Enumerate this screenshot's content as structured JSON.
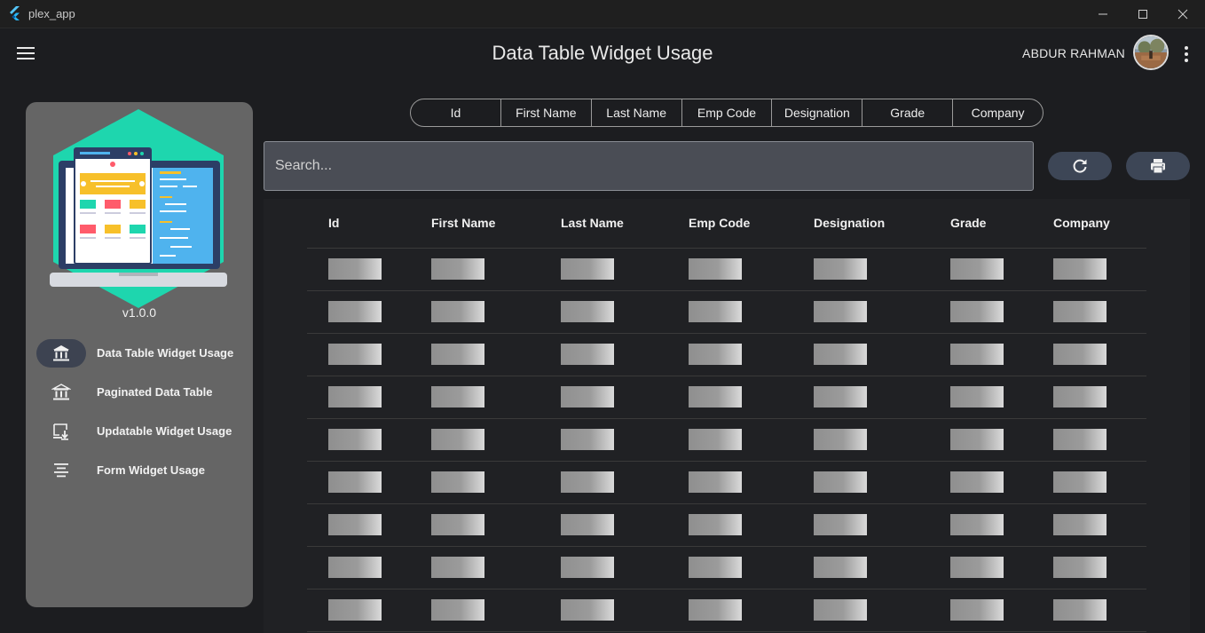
{
  "window": {
    "title": "plex_app"
  },
  "appbar": {
    "title": "Data Table Widget Usage",
    "user_name": "ABDUR RAHMAN"
  },
  "sidebar": {
    "version": "v1.0.0",
    "items": [
      {
        "label": "Data Table Widget Usage",
        "icon": "bank-icon",
        "active": true
      },
      {
        "label": "Paginated Data Table",
        "icon": "bank-icon",
        "active": false
      },
      {
        "label": "Updatable Widget Usage",
        "icon": "download-to-screen-icon",
        "active": false
      },
      {
        "label": "Form Widget Usage",
        "icon": "align-center-icon",
        "active": false
      }
    ]
  },
  "column_chips": [
    "Id",
    "First Name",
    "Last Name",
    "Emp Code",
    "Designation",
    "Grade",
    "Company"
  ],
  "search": {
    "placeholder": "Search...",
    "value": ""
  },
  "table": {
    "headers": [
      "Id",
      "First Name",
      "Last Name",
      "Emp Code",
      "Designation",
      "Grade",
      "Company"
    ],
    "row_count_visible": 9,
    "rows_state": "loading-shimmer"
  },
  "colors": {
    "background": "#1c1d20",
    "sidebar": "#656565",
    "active_nav": "#3d4351",
    "search_bg": "#4a4d55",
    "round_button": "#3d4656",
    "hero_teal": "#1ed6ae"
  }
}
